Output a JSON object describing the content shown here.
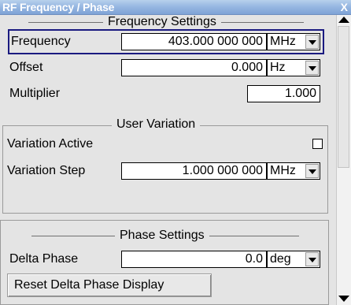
{
  "window": {
    "title": "RF Frequency / Phase",
    "close_label": "X"
  },
  "frequency_settings": {
    "title": "Frequency Settings",
    "frequency": {
      "label": "Frequency",
      "value": "403.000 000 000",
      "unit": "MHz"
    },
    "offset": {
      "label": "Offset",
      "value": "0.000",
      "unit": "Hz"
    },
    "multiplier": {
      "label": "Multiplier",
      "value": "1.000"
    }
  },
  "user_variation": {
    "title": "User Variation",
    "variation_active": {
      "label": "Variation Active",
      "checked": false
    },
    "variation_step": {
      "label": "Variation Step",
      "value": "1.000 000 000",
      "unit": "MHz"
    }
  },
  "phase_settings": {
    "title": "Phase Settings",
    "delta_phase": {
      "label": "Delta Phase",
      "value": "0.0",
      "unit": "deg"
    },
    "reset_button": "Reset Delta Phase Display"
  }
}
